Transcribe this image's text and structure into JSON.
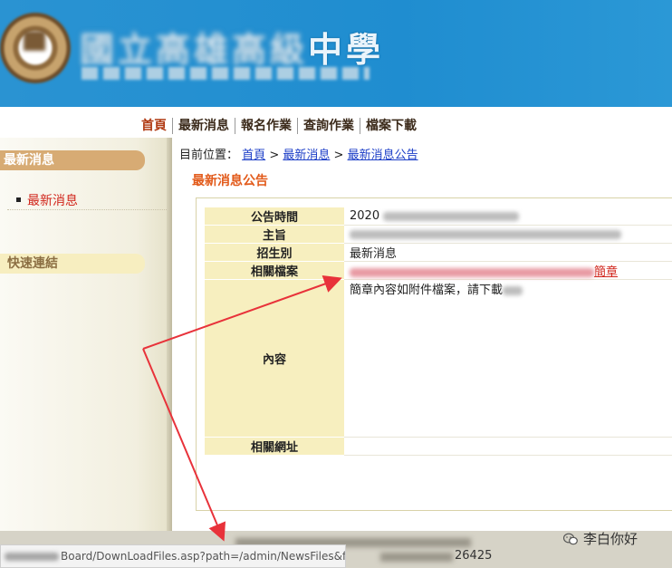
{
  "header": {
    "school_name_visible": "中學"
  },
  "nav": {
    "items": [
      "首頁",
      "最新消息",
      "報名作業",
      "查詢作業",
      "檔案下載"
    ]
  },
  "sidebar": {
    "section1_title": "最新消息",
    "section1_item": "最新消息",
    "section2_title": "快速連結"
  },
  "breadcrumb": {
    "prefix": "目前位置：",
    "crumbs": [
      "首頁",
      "最新消息",
      "最新消息公告"
    ],
    "separator": ">"
  },
  "page_title": "最新消息公告",
  "detail": {
    "labels": [
      "公告時間",
      "主旨",
      "招生別",
      "相關檔案",
      "內容",
      "相關網址"
    ],
    "time_prefix": "2020",
    "category": "最新消息",
    "file_link_tail": "簡章",
    "content_text": "簡章內容如附件檔案，請下載"
  },
  "footer": {
    "number": "26425"
  },
  "status_bar": {
    "url_text": "Board/DownLoadFiles.asp?path=/admin/NewsFiles&file..."
  },
  "watermark": {
    "text": "李白你好"
  },
  "colors": {
    "banner_blue": "#1f8dd0",
    "accent_orange": "#e25a1a",
    "link_red": "#d1261c",
    "label_bg": "#f7efbf",
    "arrow_red": "#e8323a"
  }
}
